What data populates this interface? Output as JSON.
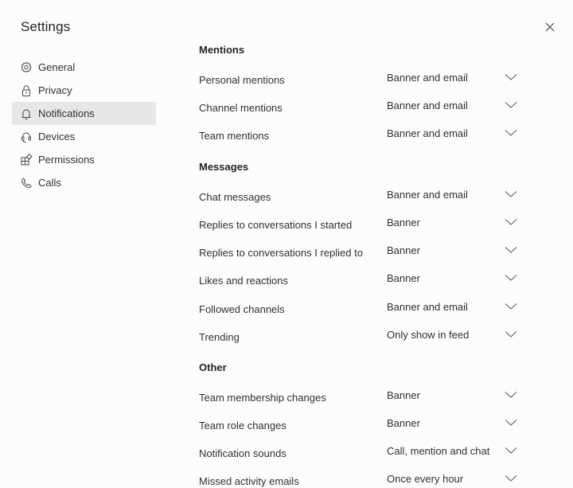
{
  "header": {
    "title": "Settings"
  },
  "nav": {
    "items": [
      {
        "label": "General",
        "icon": "gear-icon"
      },
      {
        "label": "Privacy",
        "icon": "lock-icon"
      },
      {
        "label": "Notifications",
        "icon": "bell-icon",
        "selected": true
      },
      {
        "label": "Devices",
        "icon": "headset-icon"
      },
      {
        "label": "Permissions",
        "icon": "apps-icon"
      },
      {
        "label": "Calls",
        "icon": "phone-icon"
      }
    ]
  },
  "sections": {
    "mentions": {
      "title": "Mentions",
      "rows": [
        {
          "label": "Personal mentions",
          "value": "Banner and email"
        },
        {
          "label": "Channel mentions",
          "value": "Banner and email"
        },
        {
          "label": "Team mentions",
          "value": "Banner and email"
        }
      ]
    },
    "messages": {
      "title": "Messages",
      "rows": [
        {
          "label": "Chat messages",
          "value": "Banner and email"
        },
        {
          "label": "Replies to conversations I started",
          "value": "Banner"
        },
        {
          "label": "Replies to conversations I replied to",
          "value": "Banner"
        },
        {
          "label": "Likes and reactions",
          "value": "Banner"
        },
        {
          "label": "Followed channels",
          "value": "Banner and email"
        },
        {
          "label": "Trending",
          "value": "Only show in feed"
        }
      ]
    },
    "other": {
      "title": "Other",
      "rows": [
        {
          "label": "Team membership changes",
          "value": "Banner"
        },
        {
          "label": "Team role changes",
          "value": "Banner"
        },
        {
          "label": "Notification sounds",
          "value": "Call, mention and chat"
        },
        {
          "label": "Missed activity emails",
          "value": "Once every hour"
        }
      ]
    }
  },
  "colors": {
    "background": "#fdfcfc",
    "selected_nav": "#e8e7e7",
    "text": "#323130"
  }
}
